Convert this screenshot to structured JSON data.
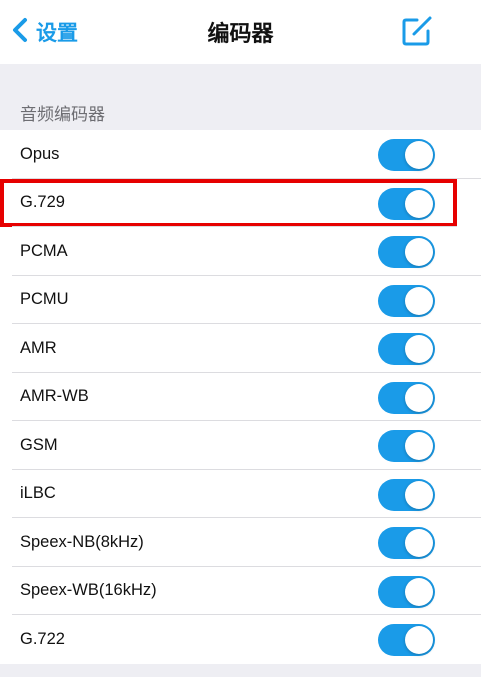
{
  "nav": {
    "back_label": "设置",
    "title": "编码器",
    "back_icon": "chevron-left-icon",
    "edit_icon": "compose-icon"
  },
  "colors": {
    "accent": "#1a9be8",
    "highlight": "#e60000",
    "group_background": "#eeeef3"
  },
  "section": {
    "header": "音频编码器"
  },
  "codecs": [
    {
      "label": "Opus",
      "enabled": true
    },
    {
      "label": "G.729",
      "enabled": true,
      "highlighted": true
    },
    {
      "label": "PCMA",
      "enabled": true
    },
    {
      "label": "PCMU",
      "enabled": true
    },
    {
      "label": "AMR",
      "enabled": true
    },
    {
      "label": "AMR-WB",
      "enabled": true
    },
    {
      "label": "GSM",
      "enabled": true
    },
    {
      "label": "iLBC",
      "enabled": true
    },
    {
      "label": "Speex-NB(8kHz)",
      "enabled": true
    },
    {
      "label": "Speex-WB(16kHz)",
      "enabled": true
    },
    {
      "label": "G.722",
      "enabled": true
    }
  ]
}
